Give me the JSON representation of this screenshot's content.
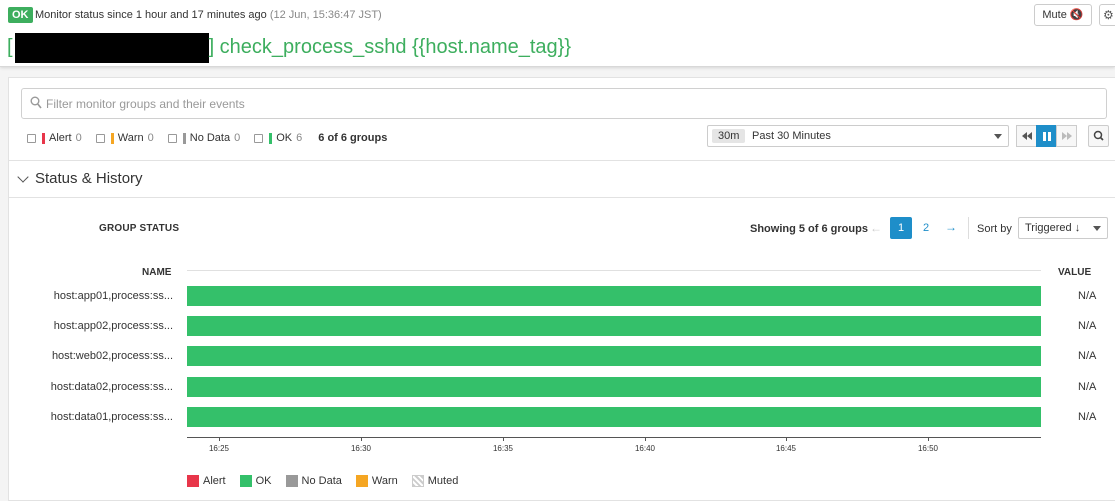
{
  "header": {
    "status_badge": "OK",
    "status_text": "Monitor status since 1 hour and 17 minutes ago",
    "status_timestamp": "(12 Jun, 15:36:47 JST)",
    "title_open": "[",
    "title_rest": "] check_process_sshd {{host.name_tag}}",
    "mute_label": "Mute 🔇",
    "gear_icon": "⚙"
  },
  "search": {
    "placeholder": "Filter monitor groups and their events"
  },
  "filters": {
    "items": [
      {
        "label": "Alert",
        "count": "0",
        "color": "#e8364a"
      },
      {
        "label": "Warn",
        "count": "0",
        "color": "#f5a623"
      },
      {
        "label": "No Data",
        "count": "0",
        "color": "#999999"
      },
      {
        "label": "OK",
        "count": "6",
        "color": "#34c06a"
      }
    ],
    "groups_count": "6 of 6 groups"
  },
  "time_selector": {
    "chip": "30m",
    "label": "Past 30 Minutes"
  },
  "section": {
    "title": "Status & History"
  },
  "group_status": {
    "title": "GROUP STATUS",
    "showing": "Showing 5 of 6 groups",
    "pages": [
      "1",
      "2"
    ],
    "sort_label": "Sort by",
    "sort_value": "Triggered ↓",
    "col_name": "NAME",
    "col_value": "VALUE",
    "rows": [
      {
        "name": "host:app01,process:ss...",
        "value": "N/A",
        "status": "OK"
      },
      {
        "name": "host:app02,process:ss...",
        "value": "N/A",
        "status": "OK"
      },
      {
        "name": "host:web02,process:ss...",
        "value": "N/A",
        "status": "OK"
      },
      {
        "name": "host:data02,process:ss...",
        "value": "N/A",
        "status": "OK"
      },
      {
        "name": "host:data01,process:ss...",
        "value": "N/A",
        "status": "OK"
      }
    ],
    "axis_ticks": [
      "16:25",
      "16:30",
      "16:35",
      "16:40",
      "16:45",
      "16:50"
    ],
    "legend": [
      {
        "label": "Alert",
        "color": "#e8364a"
      },
      {
        "label": "OK",
        "color": "#34c06a"
      },
      {
        "label": "No Data",
        "color": "#999999"
      },
      {
        "label": "Warn",
        "color": "#f5a623"
      },
      {
        "label": "Muted",
        "color": "hatched"
      }
    ]
  }
}
